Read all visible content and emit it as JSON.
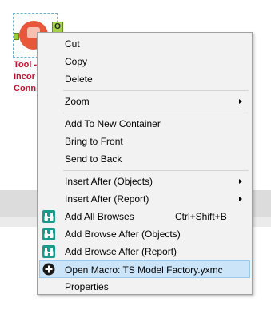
{
  "canvas": {
    "tool_label": "Tool -\nIncor\nConn",
    "output_anchor": "O"
  },
  "menu": {
    "items": [
      {
        "label": "Cut"
      },
      {
        "label": "Copy"
      },
      {
        "label": "Delete"
      },
      {
        "label": "Zoom",
        "submenu": true
      },
      {
        "label": "Add To New Container"
      },
      {
        "label": "Bring to Front"
      },
      {
        "label": "Send to Back"
      },
      {
        "label": "Insert After (Objects)",
        "submenu": true
      },
      {
        "label": "Insert After (Report)",
        "submenu": true
      },
      {
        "label": "Add All Browses",
        "shortcut": "Ctrl+Shift+B",
        "icon": "binoculars-icon"
      },
      {
        "label": "Add Browse After (Objects)",
        "icon": "binoculars-icon"
      },
      {
        "label": "Add Browse After (Report)",
        "icon": "binoculars-icon"
      },
      {
        "label": "Open Macro: TS Model Factory.yxmc",
        "icon": "plus-circle-icon",
        "highlighted": true
      },
      {
        "label": "Properties"
      }
    ]
  },
  "colors": {
    "menu_bg": "#f2f2f2",
    "highlight_bg": "#cce4f7",
    "highlight_border": "#99c9ef",
    "tool_label": "#c8102e",
    "browse_icon": "#1a9a8a"
  }
}
